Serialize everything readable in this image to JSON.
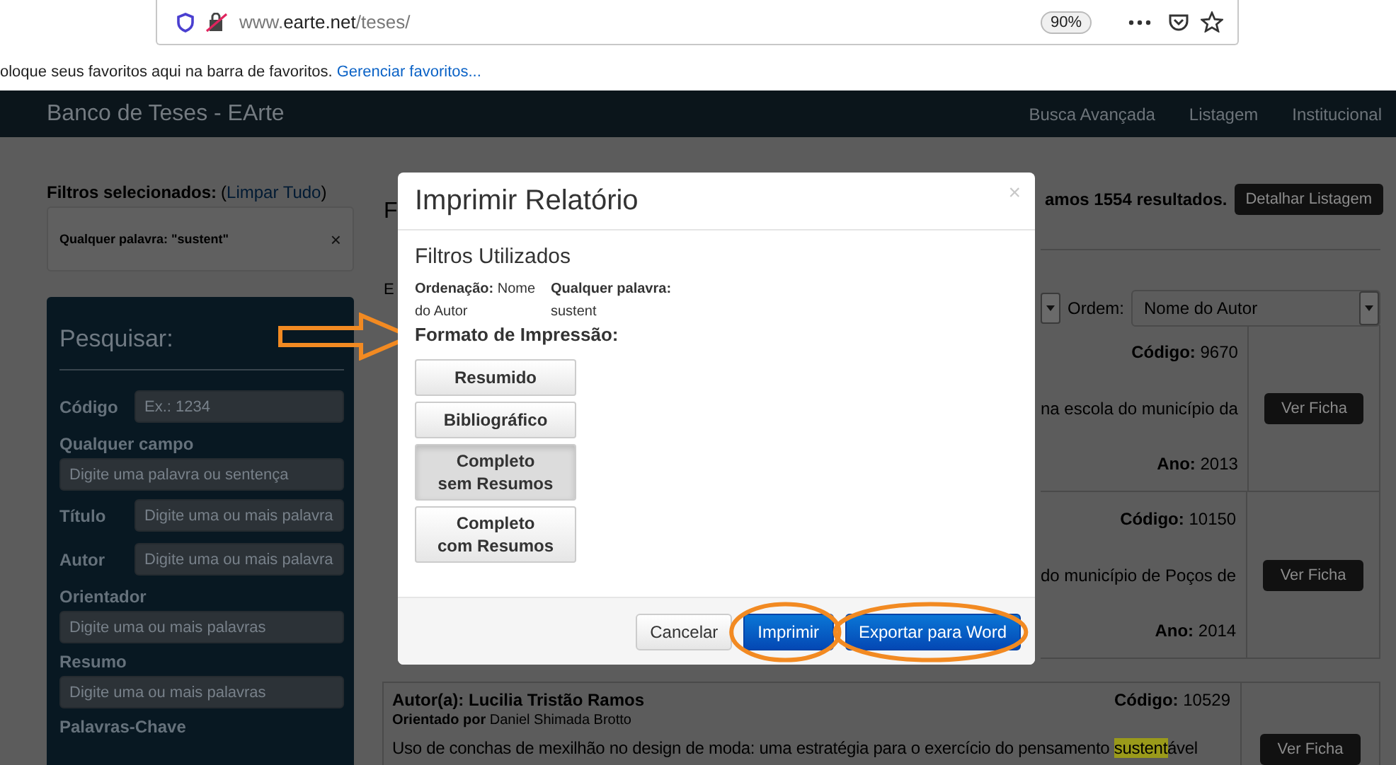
{
  "browser": {
    "url_prefix": "www.",
    "url_domain": "earte.net",
    "url_path": "/teses/",
    "zoom": "90%",
    "bookmarks_text": "oloque seus favoritos aqui na barra de favoritos.",
    "bookmarks_link": "Gerenciar favoritos..."
  },
  "navbar": {
    "brand": "Banco de Teses - EArte",
    "links": [
      "Busca Avançada",
      "Listagem",
      "Institucional"
    ]
  },
  "filters": {
    "heading": "Filtros selecionados:",
    "clear_open": "(",
    "clear_link": "Limpar Tudo",
    "clear_close": ")",
    "items": [
      {
        "label": "Qualquer palavra: \"sustent\"",
        "remove": "×"
      }
    ]
  },
  "search": {
    "title": "Pesquisar:",
    "fields": [
      {
        "label": "Código",
        "placeholder": "Ex.: 1234",
        "kind": "inline"
      },
      {
        "label": "Qualquer campo",
        "placeholder": "Digite uma palavra ou sentença",
        "kind": "stacked"
      },
      {
        "label": "Título",
        "placeholder": "Digite uma ou mais palavra",
        "kind": "inline"
      },
      {
        "label": "Autor",
        "placeholder": "Digite uma ou mais palavra",
        "kind": "inline"
      },
      {
        "label": "Orientador",
        "placeholder": "Digite uma ou mais palavras",
        "kind": "stacked"
      },
      {
        "label": "Resumo",
        "placeholder": "Digite uma ou mais palavras",
        "kind": "stacked"
      },
      {
        "label": "Palavras-Chave",
        "kind": "label"
      }
    ]
  },
  "results": {
    "partial_heading": "F",
    "count_text": "amos 1554 resultados.",
    "detail_button": "Detalhar Listagem",
    "partial_label": "E",
    "order_label": "Ordem:",
    "order_value": "Nome do Autor",
    "rows": [
      {
        "kind": "partial",
        "code_label": "Código:",
        "code": "9670",
        "snippet": "na escola do município da",
        "year_label": "Ano:",
        "year": "2013",
        "button": "Ver Ficha"
      },
      {
        "kind": "partial",
        "code_label": "Código:",
        "code": "10150",
        "snippet": "do município de Poços de",
        "year_label": "Ano:",
        "year": "2014",
        "button": "Ver Ficha"
      },
      {
        "kind": "full",
        "author_label": "Autor(a):",
        "author": "Lucilia Tristão Ramos",
        "code_label": "Código:",
        "code": "10529",
        "advisor_label": "Orientado por",
        "advisor": "Daniel Shimada Brotto",
        "snippet_before": "Uso de conchas de mexilhão no design de moda: uma estratégia para o exercício do pensamento ",
        "highlight": "sustent",
        "snippet_after": "ável",
        "button": "Ver Ficha"
      }
    ]
  },
  "modal": {
    "title": "Imprimir Relatório",
    "close": "×",
    "filters_heading": "Filtros Utilizados",
    "used_filters": [
      "**Ordenação:** Nome do Autor",
      "**Qualquer palavra:** sustent"
    ],
    "format_heading": "Formato de Impressão:",
    "format_pointer": true,
    "formats": [
      {
        "label": "Resumido",
        "selected": false
      },
      {
        "label": "Bibliográfico",
        "selected": false
      },
      {
        "label": "Completo sem Resumos",
        "selected": true
      },
      {
        "label": "Completo com Resumos",
        "selected": false
      }
    ],
    "actions": [
      {
        "label": "Cancelar",
        "kind": "default",
        "circled": false
      },
      {
        "label": "Imprimir",
        "kind": "primary",
        "circled": true
      },
      {
        "label": "Exportar para Word",
        "kind": "primary",
        "circled": true
      }
    ]
  }
}
